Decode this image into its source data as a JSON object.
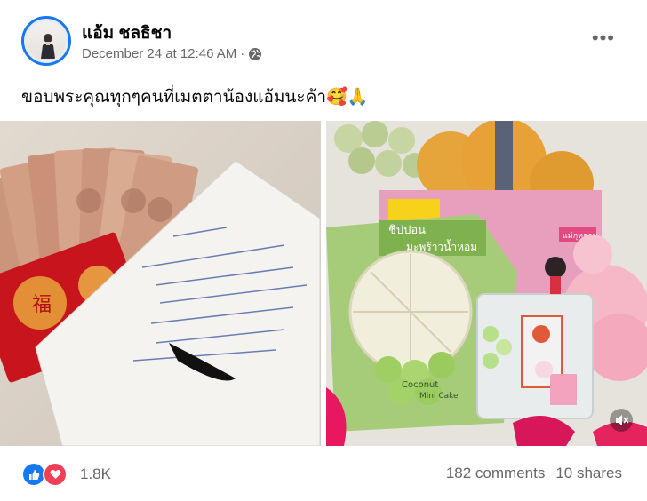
{
  "post": {
    "author": "แอ้ม ชลธิชา",
    "timestamp": "December 24 at 12:46 AM",
    "separator": "·",
    "privacy_icon": "globe-icon",
    "more_label": "•••",
    "caption": "ขอบพระคุณทุกๆคนที่เมตตาน้องแอ้มนะค้า🥰🙏"
  },
  "photos": {
    "left": {
      "description_icon": "money-envelope-letter",
      "envelope_text": "福"
    },
    "right": {
      "product_brand": "ชิปปอน",
      "product_name": "มะพร้าวน้ำหอม",
      "product_tag": "Coconut",
      "product_sub": "Mini Cake",
      "box_tag": "แม่กุหลาบ"
    }
  },
  "footer": {
    "reaction_count": "1.8K",
    "comments": "182 comments",
    "shares": "10 shares"
  },
  "colors": {
    "accent": "#1877f2",
    "love": "#f33e58",
    "secondary_text": "#65676b"
  }
}
